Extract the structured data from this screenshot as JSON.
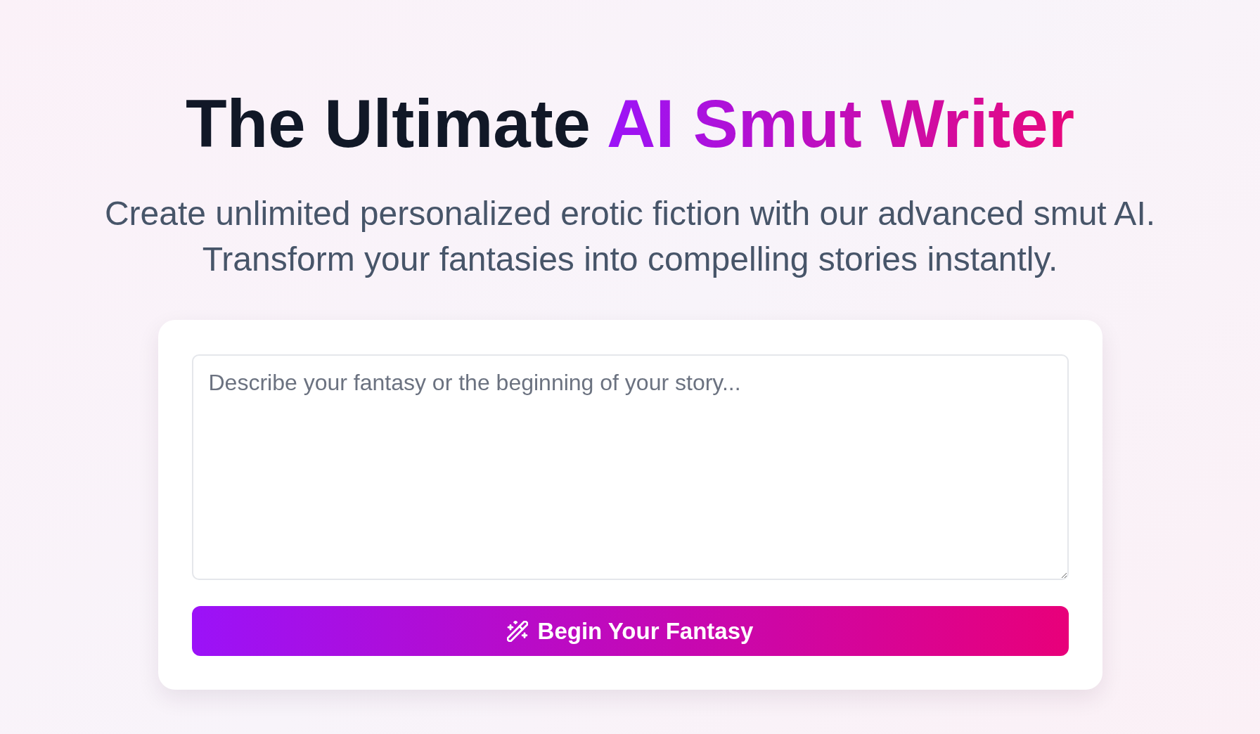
{
  "heading": {
    "text": "The Ultimate",
    "highlight": "AI Smut Writer"
  },
  "subtitle": "Create unlimited personalized erotic fiction with our advanced smut AI. Transform your fantasies into compelling stories instantly.",
  "story_input": {
    "placeholder": "Describe your fantasy or the beginning of your story..."
  },
  "submit_button": {
    "label": "Begin Your Fantasy"
  }
}
